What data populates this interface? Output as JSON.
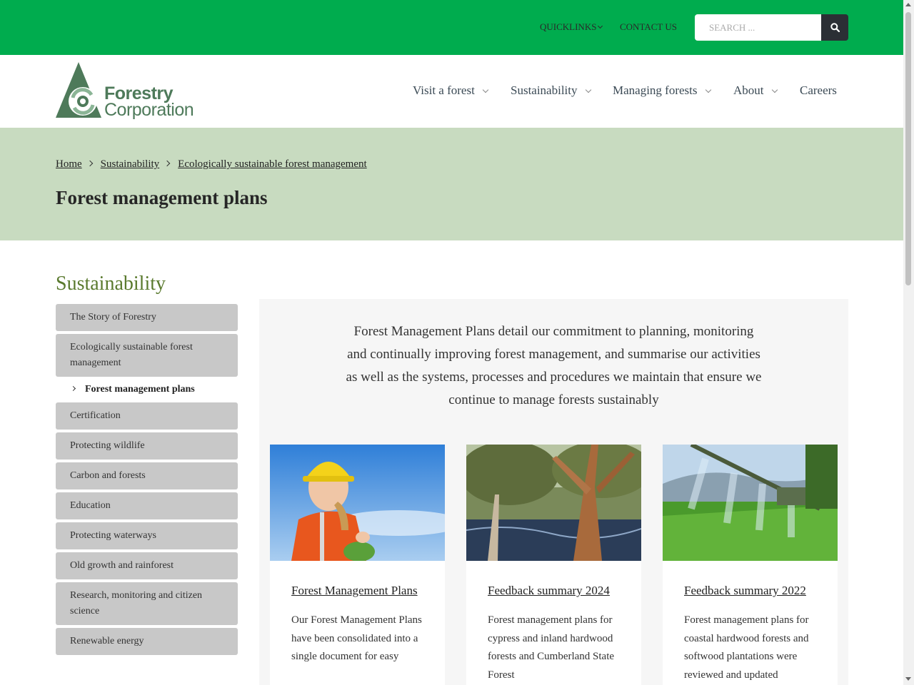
{
  "topbar": {
    "quicklinks_label": "QUICKLINKS",
    "contact_label": "CONTACT US",
    "search_placeholder": "SEARCH ...",
    "accent": "#00ac4e"
  },
  "header": {
    "logo_line1": "Forestry",
    "logo_line2": "Corporation",
    "nav": [
      {
        "label": "Visit a forest"
      },
      {
        "label": "Sustainability"
      },
      {
        "label": "Managing forests"
      },
      {
        "label": "About"
      },
      {
        "label": "Careers"
      }
    ]
  },
  "hero": {
    "breadcrumb": [
      "Home",
      "Sustainability",
      "Ecologically sustainable forest management"
    ],
    "title": "Forest management plans",
    "background": "#c8dbc0"
  },
  "sidebar": {
    "title": "Sustainability",
    "items": [
      "The Story of Forestry",
      "Ecologically sustainable forest management",
      "Forest management plans",
      "Certification",
      "Protecting wildlife",
      "Carbon and forests",
      "Education",
      "Protecting waterways",
      "Old growth and rainforest",
      "Research, monitoring and citizen science",
      "Renewable energy"
    ]
  },
  "main": {
    "intro": "Forest Management Plans detail our commitment to planning, monitoring and continually improving forest management, and summarise our activities as well as the systems, processes and procedures we maintain that ensure we continue to manage forests sustainably",
    "cards": [
      {
        "title": "Forest Management Plans",
        "desc": "Our Forest Management Plans have been consolidated into a single document for easy"
      },
      {
        "title": "Feedback summary 2024",
        "desc": "Forest management plans for cypress and inland hardwood forests and Cumberland State Forest"
      },
      {
        "title": "Feedback summary 2022",
        "desc": "Forest management plans for coastal hardwood forests and softwood plantations were reviewed and updated"
      }
    ]
  }
}
